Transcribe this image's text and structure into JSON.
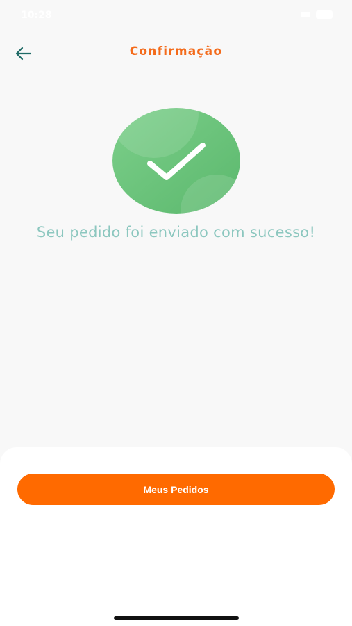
{
  "status_bar": {
    "time": "10:28"
  },
  "header": {
    "title": "Confirmação",
    "back_icon": "arrow-left-icon",
    "back_color": "#1f6b66"
  },
  "success": {
    "icon": "check-circle-icon",
    "message": "Seu pedido foi enviado com sucesso!",
    "circle_color": "#6cc27c"
  },
  "actions": {
    "orders_label": "Meus Pedidos",
    "accent_color": "#ff6a00"
  }
}
